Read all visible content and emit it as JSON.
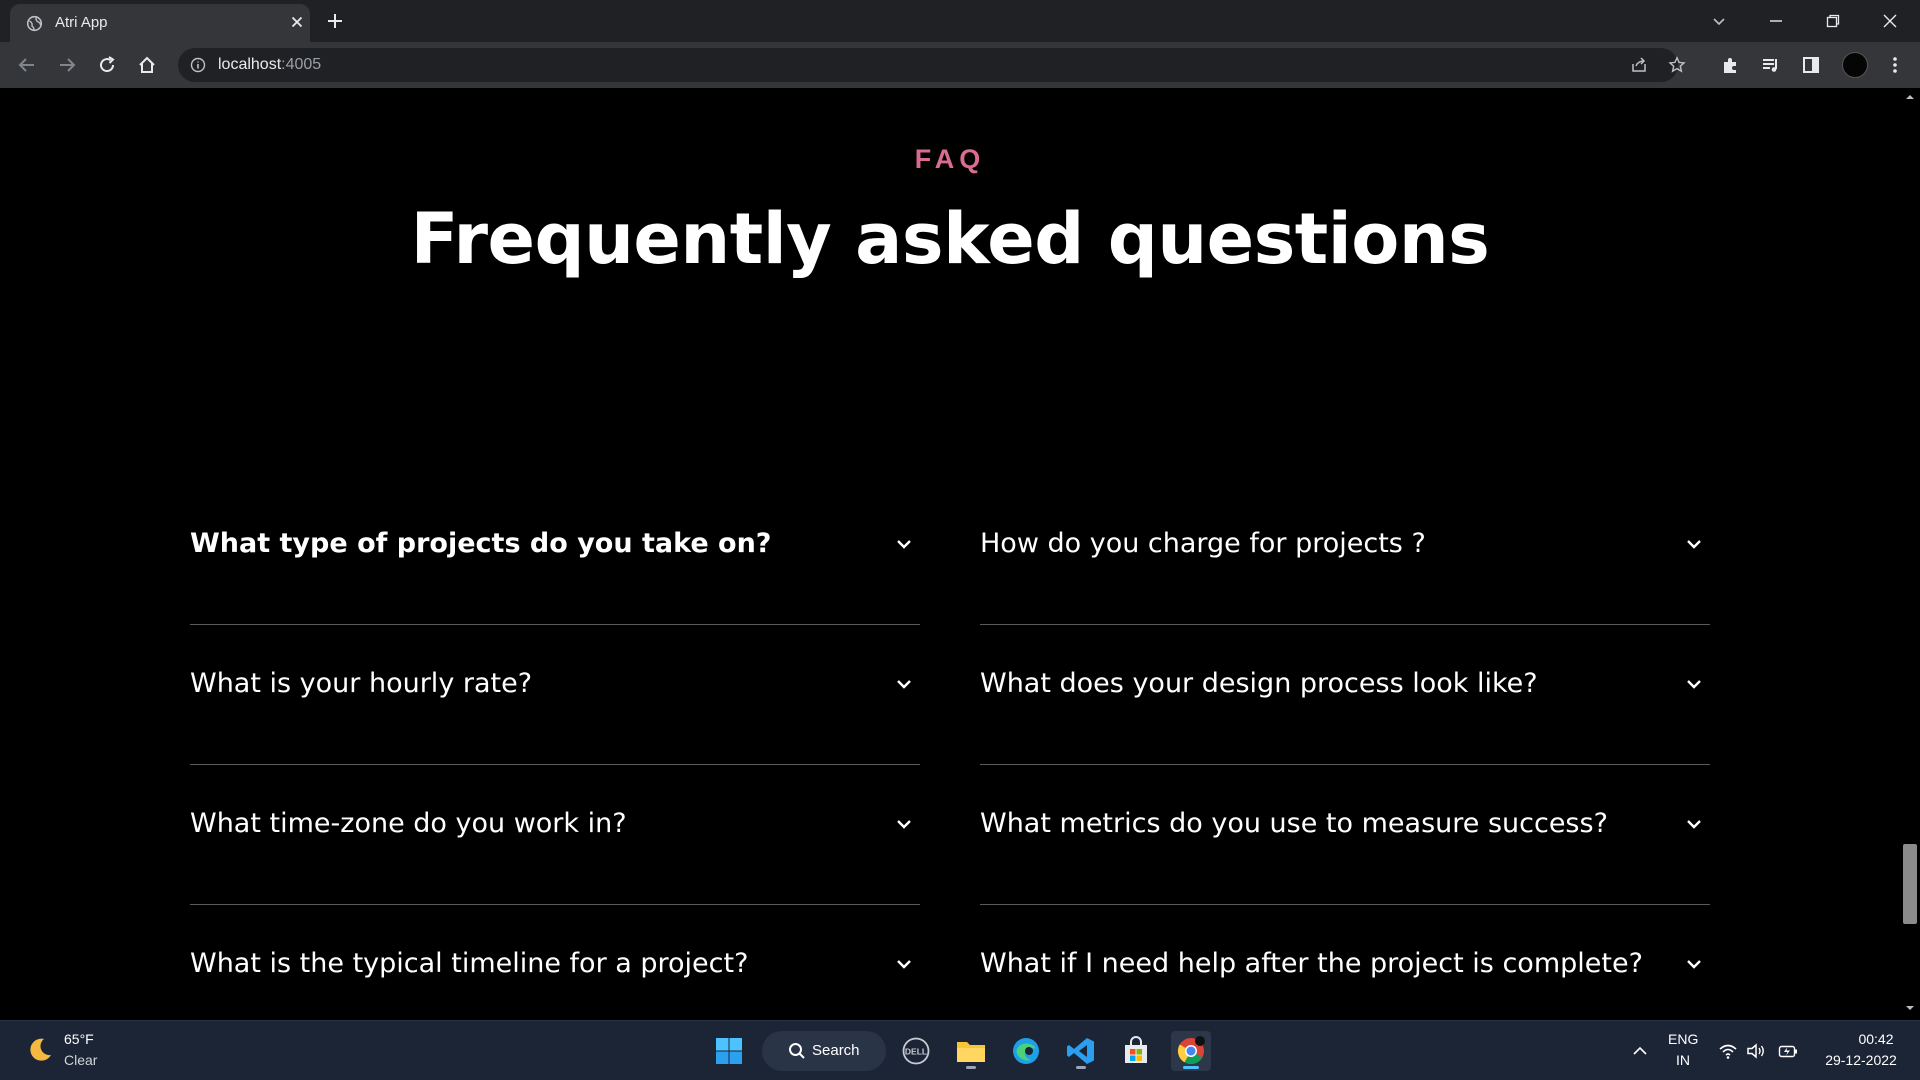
{
  "browser": {
    "tab_title": "Atri App",
    "url_host": "localhost",
    "url_port": ":4005"
  },
  "page": {
    "eyebrow": "FAQ",
    "headline": "Frequently asked questions",
    "faq_left": [
      "What type of projects do you take on?",
      "What is your hourly rate?",
      "What time-zone do you work in?",
      "What is the typical timeline for a project?"
    ],
    "faq_right": [
      "How do you charge for projects ?",
      "What does your design process look like?",
      "What metrics do you use to measure success?",
      "What if I need help after the project is complete?"
    ]
  },
  "taskbar": {
    "weather_temp": "65°F",
    "weather_desc": "Clear",
    "search_label": "Search",
    "lang_top": "ENG",
    "lang_bottom": "IN",
    "time": "00:42",
    "date": "29-12-2022",
    "dell_label": "DELL"
  },
  "colors": {
    "eyebrow_gradient_start": "#c45fd6",
    "eyebrow_gradient_end": "#f0784a",
    "page_bg": "#000000",
    "divider": "#5a5a5a"
  }
}
